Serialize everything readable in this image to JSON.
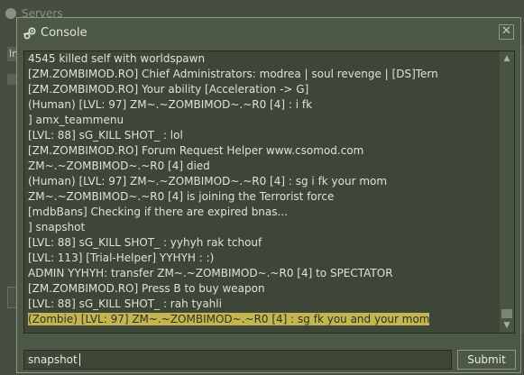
{
  "background_window": {
    "title": "Servers",
    "tab_letter": "In"
  },
  "console": {
    "title": "Console",
    "close_glyph": "✕",
    "log": [
      "4545 killed self with worldspawn",
      "[ZM.ZOMBIMOD.RO] Chief Administrators: modrea | soul revenge | [DS]Tern",
      "[ZM.ZOMBIMOD.RO] Your ability [Acceleration -> G]",
      "(Human) [LVL: 97] ZM~.~ZOMBIMOD~.~R0 [4] : i fk",
      "] amx_teammenu",
      "[LVL: 88] sG_KILL SHOT_ : lol",
      "[ZM.ZOMBIMOD.RO] Forum Request Helper www.csomod.com",
      "ZM~.~ZOMBIMOD~.~R0 [4] died",
      "(Human) [LVL: 97] ZM~.~ZOMBIMOD~.~R0 [4] : sg i fk your mom",
      "ZM~.~ZOMBIMOD~.~R0 [4] is joining the Terrorist force",
      "[mdbBans] Checking if there are expired bnas...",
      "] snapshot",
      "[LVL: 88] sG_KILL SHOT_ : yyhyh rak tchouf",
      "[LVL: 113] [Trial-Helper] YYHYH : :)",
      "ADMIN YYHYH: transfer ZM~.~ZOMBIMOD~.~R0 [4] to SPECTATOR",
      "[ZM.ZOMBIMOD.RO] Press B to buy weapon",
      "[LVL: 88] sG_KILL SHOT_ : rah tyahli",
      "(Zombie) [LVL: 97] ZM~.~ZOMBIMOD~.~R0 [4] : sg fk you and your mom"
    ],
    "highlighted_index": 17,
    "input_value": "snapshot",
    "submit_label": "Submit"
  },
  "colors": {
    "window_bg": "#4c5844",
    "log_bg": "#3e4637",
    "text": "#dde3d6",
    "highlight": "#c4b550"
  },
  "icons": {
    "title": "steam-icon",
    "close": "close-icon",
    "scroll_up": "arrow-up-icon",
    "scroll_down": "arrow-down-icon"
  }
}
